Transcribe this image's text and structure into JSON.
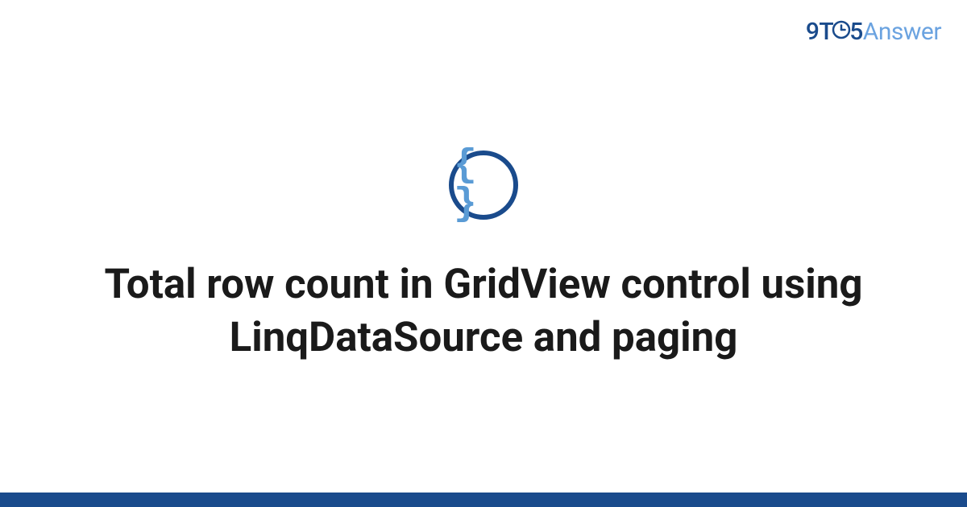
{
  "brand": {
    "nine": "9",
    "t": "T",
    "five": "5",
    "answer": "Answer"
  },
  "icon": {
    "braces": "{ }"
  },
  "title": "Total row count in GridView control using LinqDataSource and paging",
  "colors": {
    "primary": "#1a4b8c",
    "accent": "#5a9bd5",
    "light_blue": "#6ba3e0"
  }
}
